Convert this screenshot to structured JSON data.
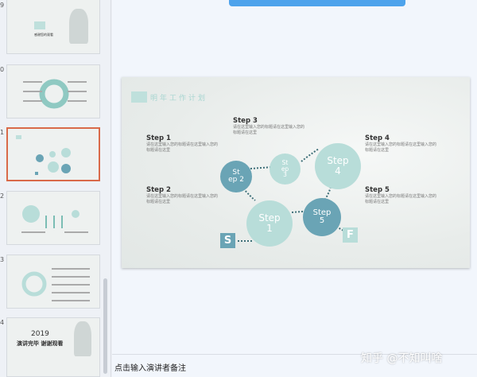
{
  "thumbnails": [
    {
      "num": "9",
      "selected": false
    },
    {
      "num": "0",
      "selected": false
    },
    {
      "num": "1",
      "selected": true
    },
    {
      "num": "2",
      "selected": false
    },
    {
      "num": "3",
      "selected": false
    },
    {
      "num": "4",
      "selected": false
    }
  ],
  "thumb_text": {
    "t9_title": "感谢您的观看",
    "t4_year": "2019",
    "t4_line": "演讲完毕 谢谢观看"
  },
  "slide": {
    "title": "明年工作计划",
    "steps": [
      {
        "title": "Step 1",
        "desc": "请在这里输入您的标题请在这里输入您的标题请在这里"
      },
      {
        "title": "Step 2",
        "desc": "请在这里输入您的标题请在这里输入您的标题请在这里"
      },
      {
        "title": "Step 3",
        "desc": "请在这里输入您的标题请在这里输入您的标题请在这里"
      },
      {
        "title": "Step 4",
        "desc": "请在这里输入您的标题请在这里输入您的标题请在这里"
      },
      {
        "title": "Step 5",
        "desc": "请在这里输入您的标题请在这里输入您的标题请在这里"
      }
    ],
    "circles": {
      "c1": "Step\n1",
      "c2": "St\nep 2",
      "c3": "St\nep\n3",
      "c4": "Step\n4",
      "c5": "Step\n5"
    },
    "start_label": "S",
    "finish_label": "F"
  },
  "notes_placeholder": "点击输入演讲者备注",
  "watermark": "知乎 @不知叫啥",
  "colors": {
    "teal_light": "#b8ddd9",
    "teal_dark": "#6aa4b5",
    "selection": "#d96a4a",
    "top_button": "#4ea3ec"
  }
}
